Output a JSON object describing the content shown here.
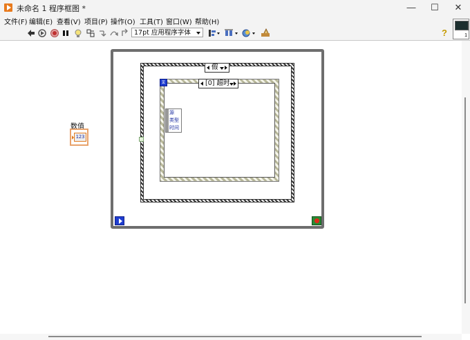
{
  "window": {
    "title": "未命名 1 程序框图 *",
    "controls": {
      "minimize": "—",
      "maximize": "☐",
      "close": "✕"
    }
  },
  "menu": [
    "文件(F)",
    "编辑(E)",
    "查看(V)",
    "项目(P)",
    "操作(O)",
    "工具(T)",
    "窗口(W)",
    "帮助(H)"
  ],
  "toolbar": {
    "font_select": "17pt 应用程序字体",
    "help_glyph": "?"
  },
  "connector_pane": {
    "number": "1"
  },
  "diagram": {
    "numeric_control": {
      "label": "数值",
      "type_label": "123"
    },
    "event_structure": {
      "selector_label": "[0] 超时"
    },
    "outer_selector": {
      "label": "假"
    },
    "event_data": {
      "rows": [
        "源",
        "类型",
        "时间"
      ]
    },
    "iteration_terminal": "i",
    "timeout_terminal": "⧖"
  },
  "colors": {
    "accent_orange": "#e87a1d",
    "terminal_blue": "#1f3ed0",
    "stop_green": "#2a8a35",
    "stop_red": "#e02a1a",
    "loop_gray": "#6e6e6e"
  }
}
